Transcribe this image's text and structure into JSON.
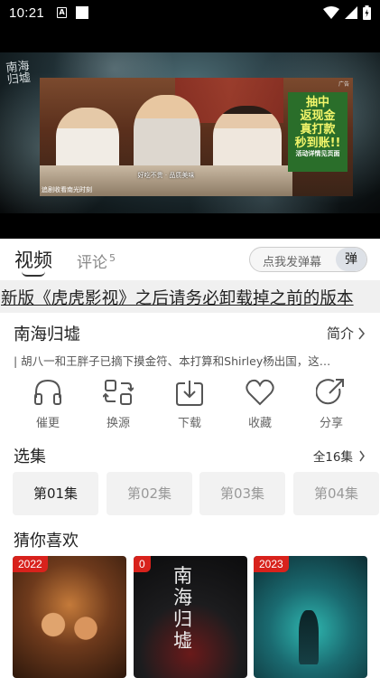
{
  "status_bar": {
    "time": "10:21",
    "sim_label": "A"
  },
  "player": {
    "poster_calligraphy": "南海归墟",
    "ad": {
      "promo_line1": "抽中",
      "promo_line2": "返现金",
      "promo_line3": "真打款",
      "promo_line4": "秒到账!!",
      "promo_small": "活动详情见页面",
      "ad_tag": "广告",
      "caption": "好吃不贵 · 品质美味",
      "sub": "追剧收看南光时刻"
    }
  },
  "tabs": {
    "video_label": "视频",
    "comment_label": "评论",
    "comment_count": "5"
  },
  "danmu": {
    "placeholder": "点我发弹幕",
    "button_label": "弹"
  },
  "notice": "新版《虎虎影视》之后请务必卸载掉之前的版本",
  "show": {
    "title": "南海归墟",
    "intro_label": "简介",
    "description": "| 胡八一和王胖子已摘下摸金符、本打算和Shirley杨出国，这…"
  },
  "actions": [
    {
      "label": "催更",
      "icon": "headphones-icon"
    },
    {
      "label": "换源",
      "icon": "swap-source-icon"
    },
    {
      "label": "下载",
      "icon": "download-icon"
    },
    {
      "label": "收藏",
      "icon": "heart-icon"
    },
    {
      "label": "分享",
      "icon": "share-icon"
    }
  ],
  "episodes": {
    "section_title": "选集",
    "total_label": "全16集",
    "items": [
      "第01集",
      "第02集",
      "第03集",
      "第04集"
    ],
    "selected": "第01集"
  },
  "recommend": {
    "section_title": "猜你喜欢",
    "items": [
      {
        "tag": "2022"
      },
      {
        "tag": "0",
        "poster_text": "南海归墟"
      },
      {
        "tag": "2023"
      }
    ]
  },
  "colors": {
    "tag_red": "#d8221c",
    "notice_bg": "#f0f0f0",
    "episode_bg": "#f2f2f2"
  }
}
